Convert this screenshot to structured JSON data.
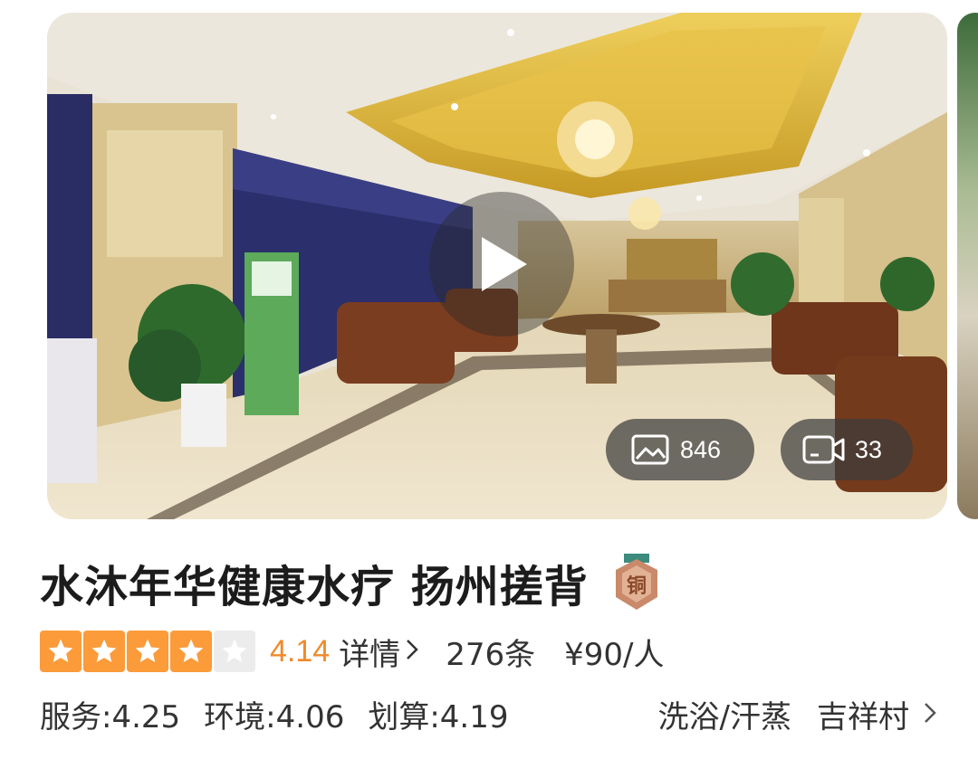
{
  "gallery": {
    "photo_count": "846",
    "video_count": "33"
  },
  "shop": {
    "name": "水沐年华健康水疗 扬州搓背",
    "medal_label": "铜",
    "stars_filled": 4,
    "stars_total": 5,
    "score": "4.14",
    "detail_label": "详情",
    "reviews": "276条",
    "price": "¥90/人"
  },
  "sub_scores": [
    {
      "label": "服务:4.25"
    },
    {
      "label": "环境:4.06"
    },
    {
      "label": "划算:4.19"
    }
  ],
  "category": "洗浴/汗蒸",
  "area": "吉祥村",
  "colors": {
    "accent_orange": "#fb9b3a",
    "score_orange": "#f08a2a",
    "medal_copper": "#c9896a"
  },
  "icons": [
    "play-icon",
    "image-icon",
    "video-camera-icon",
    "chevron-right-icon",
    "star-icon",
    "bronze-medal-icon"
  ]
}
